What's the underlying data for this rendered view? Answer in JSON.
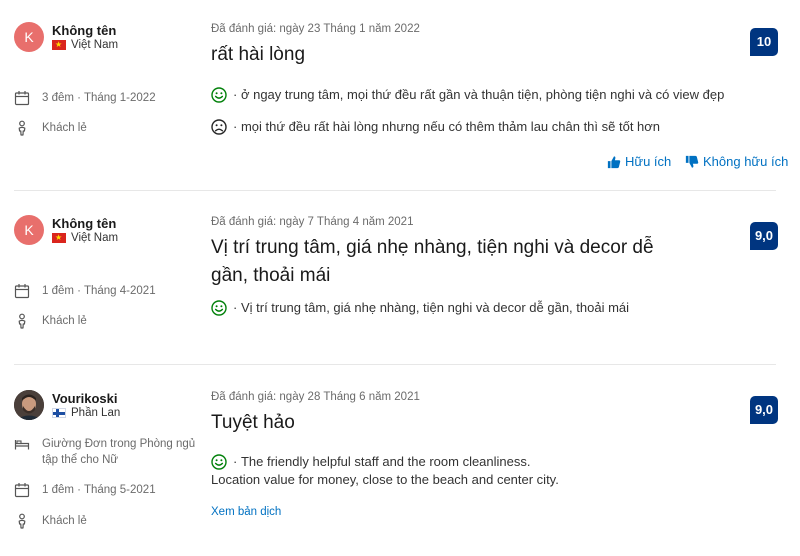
{
  "reviews": [
    {
      "avatar_letter": "K",
      "reviewer_name": "Không tên",
      "country": "Việt Nam",
      "stay": "3 đêm · Tháng 1-2022",
      "traveler_type": "Khách lẻ",
      "date_label": "Đã đánh giá: ngày 23 Tháng 1 năm 2022",
      "title": "rất hài lòng",
      "positive": "ở ngay trung tâm, mọi thứ đều rất gần và thuận tiện, phòng tiện nghi và có view đẹp",
      "negative": "mọi thứ đều rất hài lòng nhưng nếu có thêm thảm lau chân thì sẽ tốt hơn",
      "score": "10",
      "helpful_label": "Hữu ích",
      "not_helpful_label": "Không hữu ích"
    },
    {
      "avatar_letter": "K",
      "reviewer_name": "Không tên",
      "country": "Việt Nam",
      "stay": "1 đêm · Tháng 4-2021",
      "traveler_type": "Khách lẻ",
      "date_label": "Đã đánh giá: ngày 7 Tháng 4 năm 2021",
      "title_line1": "Vị trí trung tâm, giá nhẹ nhàng, tiện nghi và decor dễ",
      "title_line2": "gần, thoải mái",
      "positive": "Vị trí trung tâm, giá nhẹ nhàng, tiện nghi và decor dễ gần, thoải mái",
      "score": "9,0"
    },
    {
      "reviewer_name": "Vourikoski",
      "country": "Phần Lan",
      "room_line1": "Giường Đơn trong Phòng ngủ",
      "room_line2": "tập thể cho Nữ",
      "stay": "1 đêm · Tháng 5-2021",
      "traveler_type": "Khách lẻ",
      "date_label": "Đã đánh giá: ngày 28 Tháng 6 năm 2021",
      "title": "Tuyệt hảo",
      "positive_line1": "The friendly helpful staff and the room cleanliness.",
      "positive_line2": "Location value for money, close to the beach and center city.",
      "translate_link": "Xem bản dịch",
      "score": "9,0"
    }
  ],
  "colors": {
    "score_bg": "#003580",
    "link": "#0071c2",
    "avatar": "#e86f6c",
    "positive_face": "#008009",
    "negative_face": "#262626"
  }
}
